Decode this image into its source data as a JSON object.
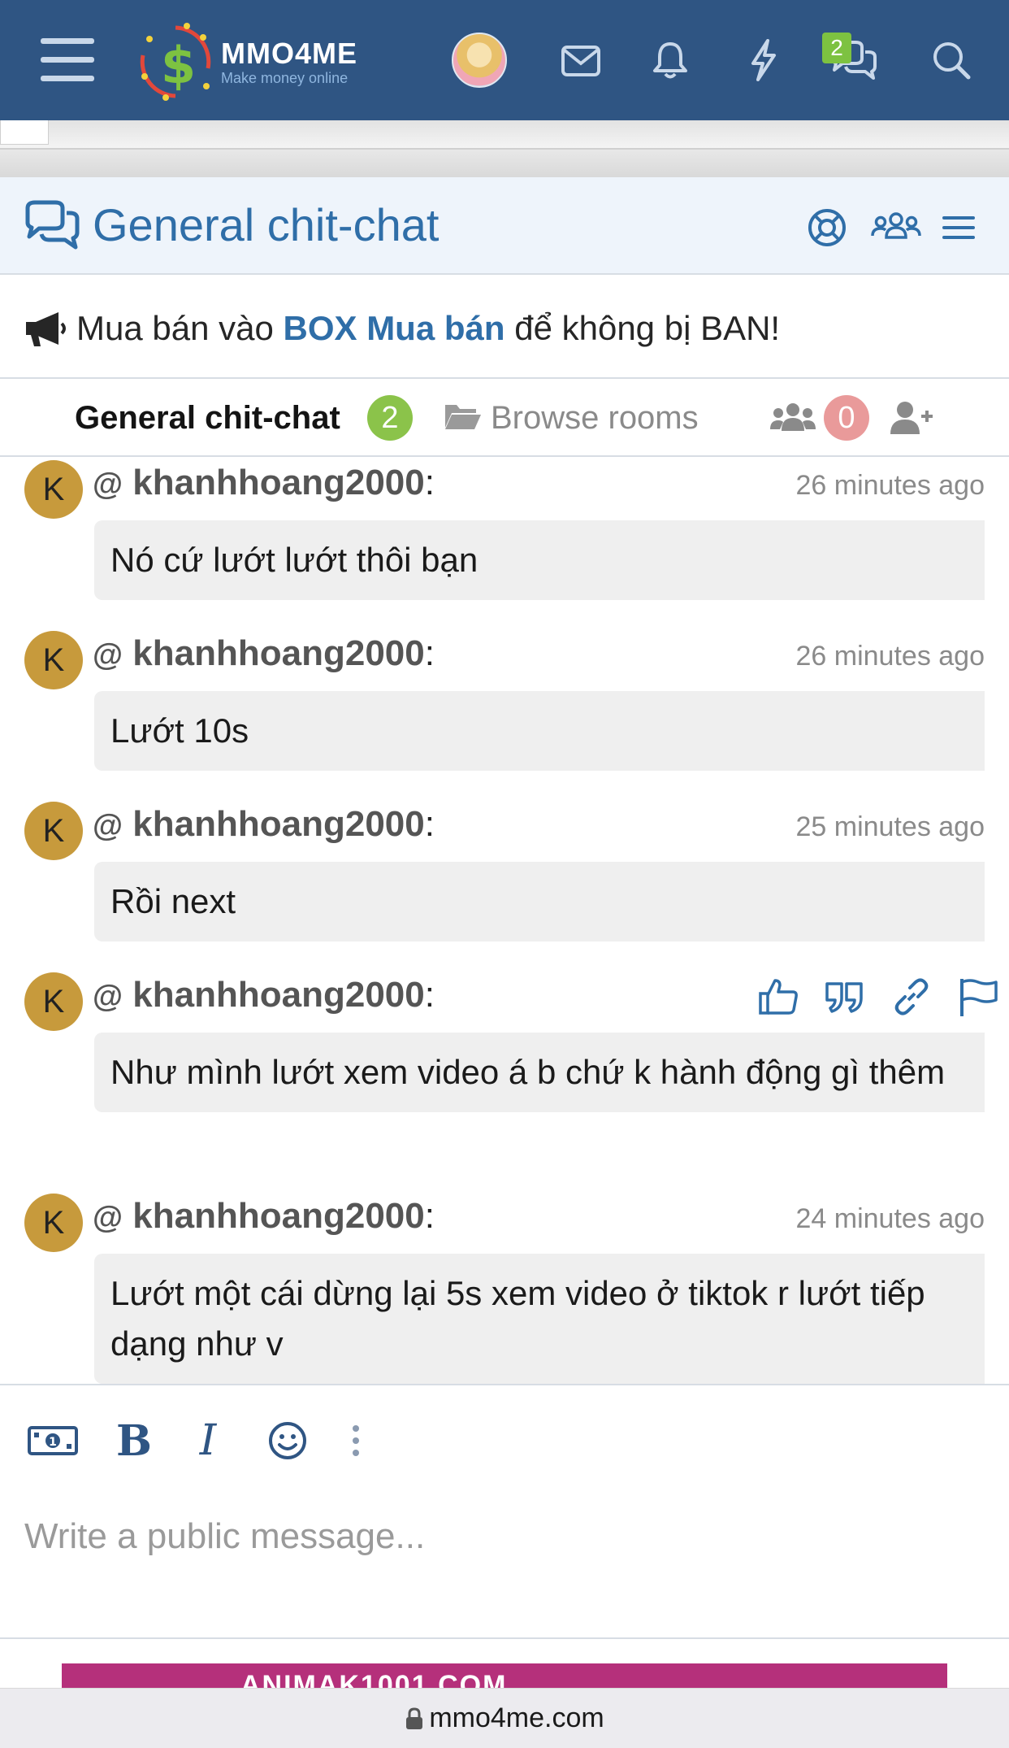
{
  "topbar": {
    "logo_name": "MMO4ME",
    "logo_tagline": "Make money online",
    "conversations_badge": "2",
    "colors": {
      "bar": "#2f5583",
      "badge": "#7dc241"
    }
  },
  "section": {
    "title": "General chit-chat",
    "icons": [
      "chat-icon",
      "help-lifebuoy-icon",
      "members-icon",
      "menu-icon"
    ]
  },
  "notice": {
    "prefix": "Mua bán vào ",
    "link": "BOX Mua bán",
    "suffix": " để không bị BAN!"
  },
  "tabs": {
    "active_label": "General chit-chat",
    "active_count": "2",
    "browse_label": "Browse rooms",
    "users_count": "0"
  },
  "messages": [
    {
      "avatar_letter": "K",
      "at": "@",
      "username": "khanhhoang2000",
      "colon": ":",
      "time": "26 minutes ago",
      "text": "Nó cứ lướt lướt thôi bạn"
    },
    {
      "avatar_letter": "K",
      "at": "@",
      "username": "khanhhoang2000",
      "colon": ":",
      "time": "26 minutes ago",
      "text": "Lướt 10s"
    },
    {
      "avatar_letter": "K",
      "at": "@",
      "username": "khanhhoang2000",
      "colon": ":",
      "time": "25 minutes ago",
      "text": "Rồi next"
    },
    {
      "avatar_letter": "K",
      "at": "@",
      "username": "khanhhoang2000",
      "colon": ":",
      "time": "",
      "text": "Như mình lướt xem video á b chứ k hành động gì thêm"
    },
    {
      "avatar_letter": "K",
      "at": "@",
      "username": "khanhhoang2000",
      "colon": ":",
      "time": "24 minutes ago",
      "text": "Lướt một cái dừng lại 5s xem video ở tiktok r lướt tiếp dạng như v"
    }
  ],
  "composer": {
    "placeholder": "Write a public message...",
    "bold_label": "B",
    "italic_label": "I"
  },
  "ad": {
    "text": "ANIMAK1001.COM"
  },
  "urlbar": {
    "domain": "mmo4me.com"
  }
}
